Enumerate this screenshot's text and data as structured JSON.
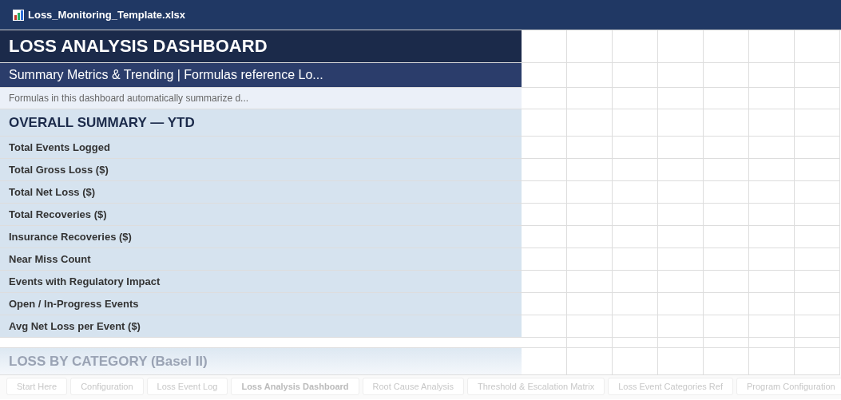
{
  "window": {
    "title": "Loss_Monitoring_Template.xlsx"
  },
  "sheet": {
    "rows": [
      {
        "kind": "title",
        "text": "LOSS ANALYSIS DASHBOARD"
      },
      {
        "kind": "subtitle",
        "text": "Summary Metrics & Trending | Formulas reference Lo..."
      },
      {
        "kind": "note",
        "text": "Formulas in this dashboard automatically summarize d..."
      },
      {
        "kind": "section",
        "text": "OVERALL SUMMARY — YTD"
      },
      {
        "kind": "metric",
        "text": "Total Events Logged"
      },
      {
        "kind": "metric",
        "text": "Total Gross Loss ($)"
      },
      {
        "kind": "metric",
        "text": "Total Net Loss ($)"
      },
      {
        "kind": "metric",
        "text": "Total Recoveries ($)"
      },
      {
        "kind": "metric",
        "text": "Insurance Recoveries ($)"
      },
      {
        "kind": "metric",
        "text": "Near Miss Count"
      },
      {
        "kind": "metric",
        "text": "Events with Regulatory Impact"
      },
      {
        "kind": "metric",
        "text": "Open / In-Progress Events"
      },
      {
        "kind": "metric",
        "text": "Avg Net Loss per Event ($)"
      },
      {
        "kind": "blank"
      },
      {
        "kind": "faded_section",
        "text": "LOSS BY CATEGORY (Basel II)"
      }
    ]
  },
  "sheet_tabs": [
    {
      "label": "Start Here",
      "selected": false
    },
    {
      "label": "Configuration",
      "selected": false
    },
    {
      "label": "Loss Event Log",
      "selected": false
    },
    {
      "label": "Loss Analysis Dashboard",
      "selected": true
    },
    {
      "label": "Root Cause Analysis",
      "selected": false
    },
    {
      "label": "Threshold & Escalation Matrix",
      "selected": false
    },
    {
      "label": "Loss Event Categories Ref",
      "selected": false
    },
    {
      "label": "Program Configuration",
      "selected": false
    }
  ]
}
